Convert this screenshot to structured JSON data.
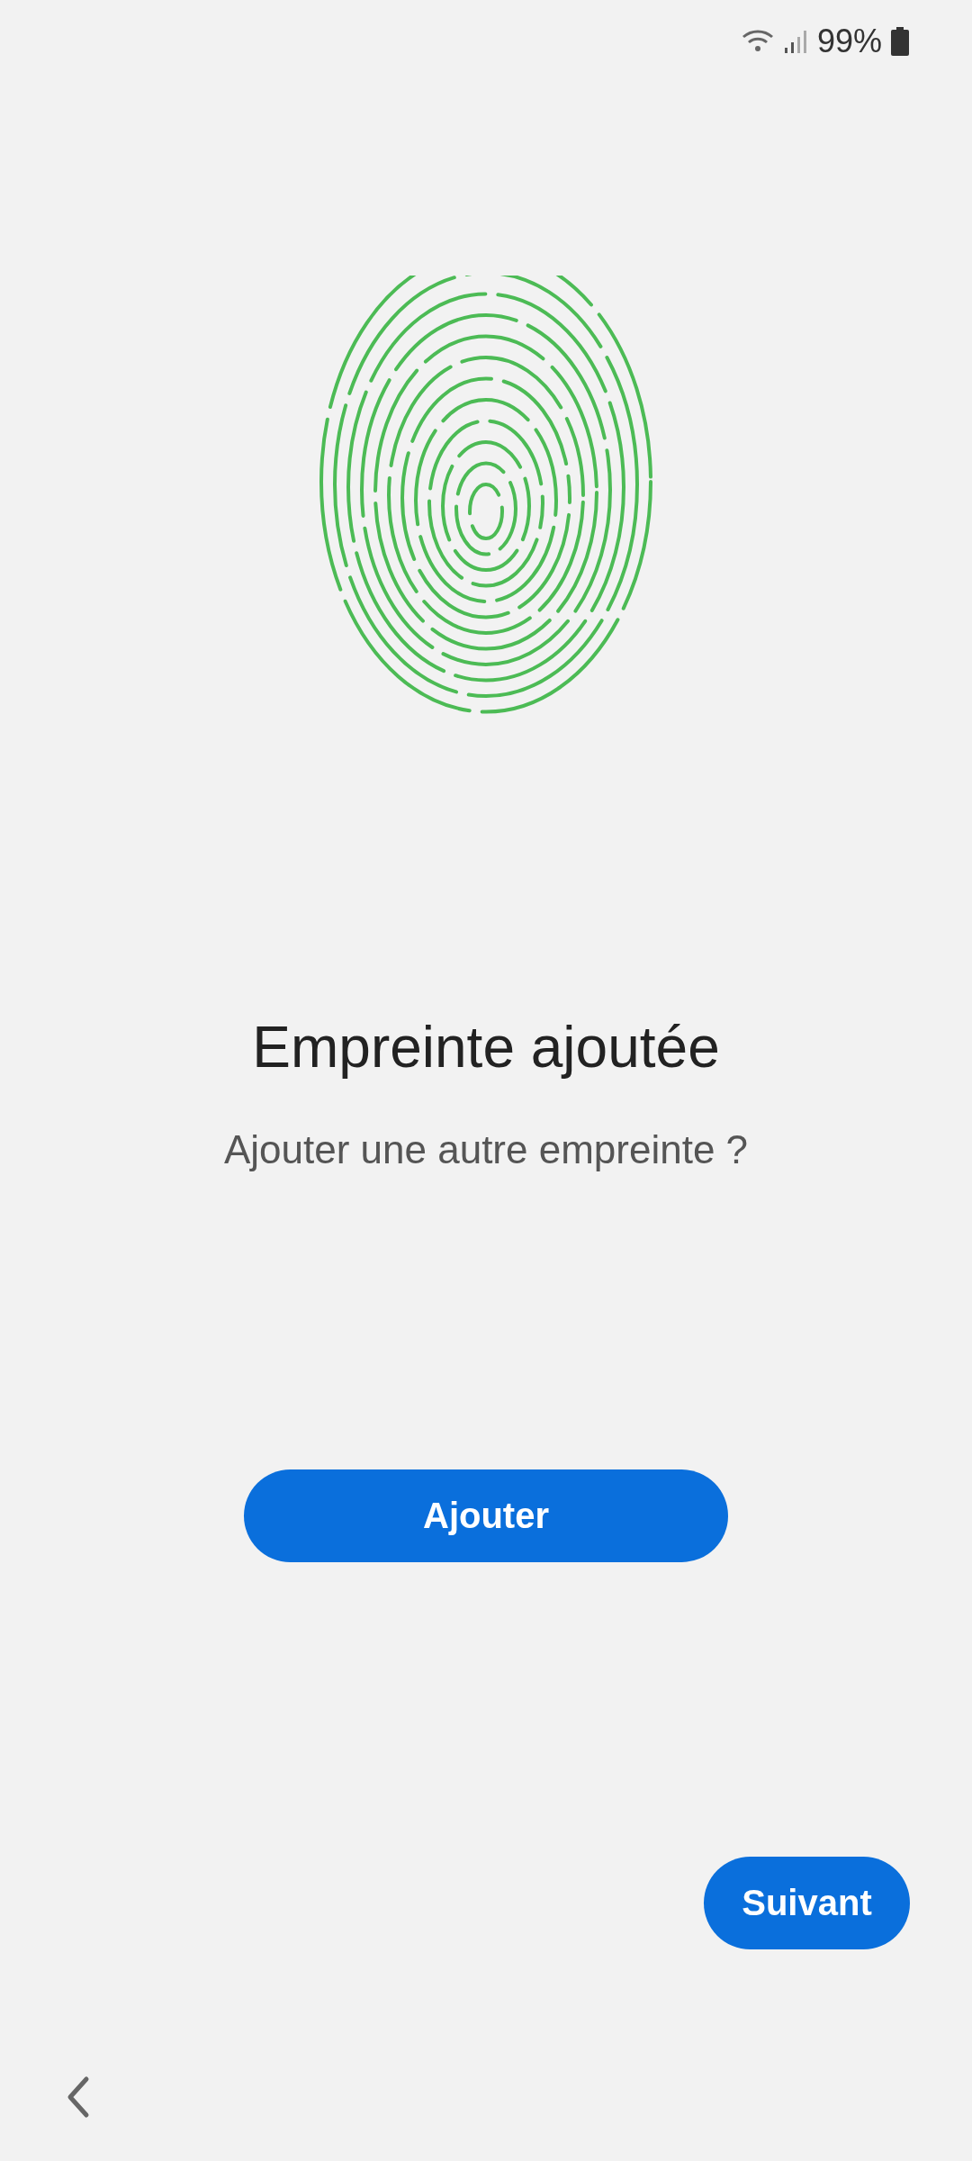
{
  "status_bar": {
    "battery": "99%"
  },
  "title": "Empreinte ajoutée",
  "subtitle": "Ajouter une autre empreinte ?",
  "add_button": {
    "label": "Ajouter"
  },
  "next_button": {
    "label": "Suivant"
  }
}
